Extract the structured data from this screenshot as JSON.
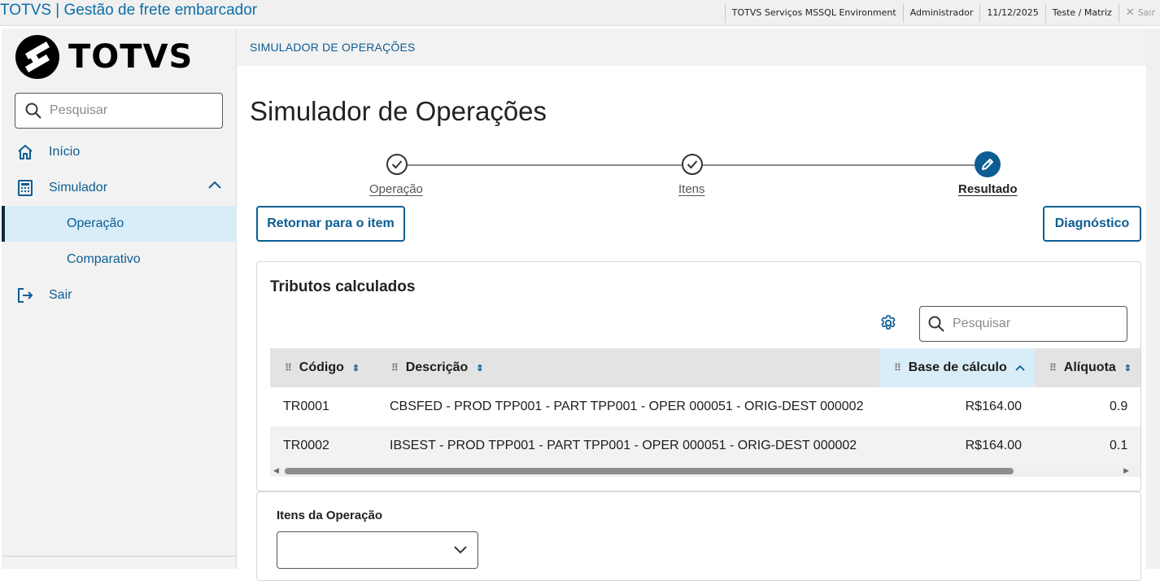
{
  "header": {
    "app_title": "TOTVS | Gestão de frete embarcador",
    "environment": "TOTVS Serviços MSSQL Environment",
    "user": "Administrador",
    "date": "11/12/2025",
    "branch": "Teste / Matriz",
    "exit_label": "Sair",
    "exit_icon": "close-icon"
  },
  "sidebar": {
    "logo_text": "TOTVS",
    "search_placeholder": "Pesquisar",
    "items": [
      {
        "label": "Início",
        "icon": "home-icon"
      },
      {
        "label": "Simulador",
        "icon": "calculator-icon",
        "expanded": true
      },
      {
        "label": "Operação",
        "active": true
      },
      {
        "label": "Comparativo"
      },
      {
        "label": "Sair",
        "icon": "logout-icon"
      }
    ]
  },
  "main": {
    "breadcrumb": "SIMULADOR DE OPERAÇÕES",
    "title": "Simulador de Operações",
    "steps": [
      {
        "label": "Operação",
        "status": "done"
      },
      {
        "label": "Itens",
        "status": "done"
      },
      {
        "label": "Resultado",
        "status": "current"
      }
    ],
    "back_button": "Retornar para o item",
    "diagnostic_button": "Diagnóstico",
    "taxes": {
      "title": "Tributos calculados",
      "search_placeholder": "Pesquisar",
      "columns": [
        "Código",
        "Descrição",
        "Base de cálculo",
        "Alíquota"
      ],
      "rows": [
        {
          "codigo": "TR0001",
          "descricao": "CBSFED - PROD TPP001 - PART TPP001 - OPER 000051 - ORIG-DEST 000002",
          "base": "R$164.00",
          "aliquota": "0.9"
        },
        {
          "codigo": "TR0002",
          "descricao": "IBSEST - PROD TPP001 - PART TPP001 - OPER 000051 - ORIG-DEST 000002",
          "base": "R$164.00",
          "aliquota": "0.1"
        }
      ]
    },
    "items_section": {
      "title": "Itens da Operação",
      "selected_value": ""
    }
  },
  "colors": {
    "accent": "#0c5d92",
    "active_bg": "#d9edf9",
    "header_bg": "#e3e3e3"
  }
}
